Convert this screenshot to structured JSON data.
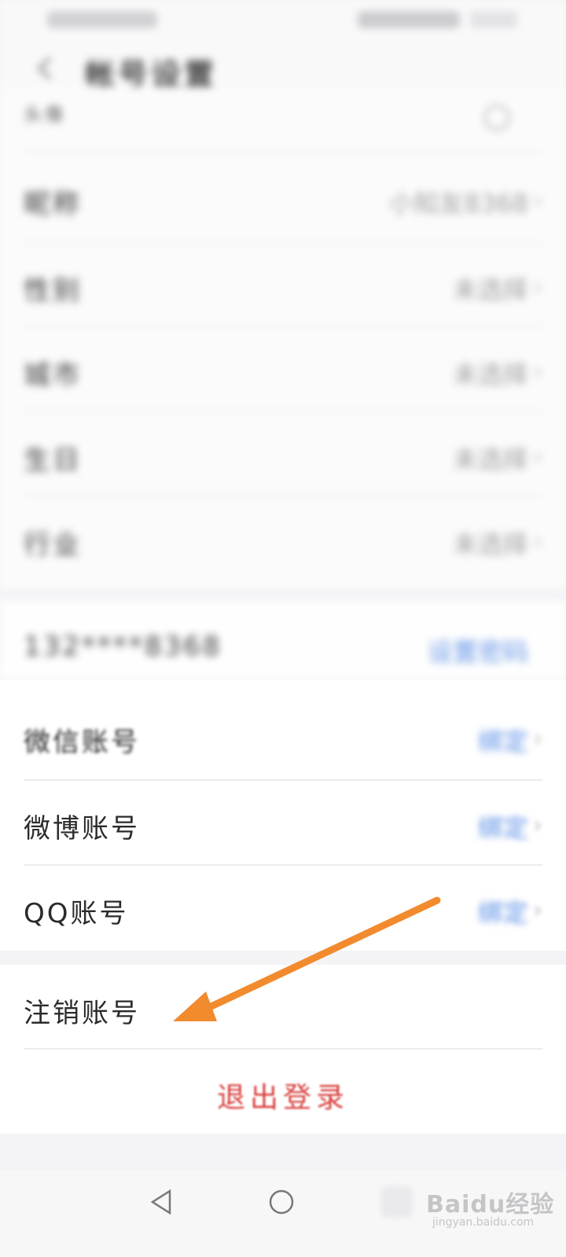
{
  "header": {
    "title": "帐号设置"
  },
  "profile_rows": [
    {
      "label": "头像",
      "value": ""
    },
    {
      "label": "昵称",
      "value": "小知友8368"
    },
    {
      "label": "性别",
      "value": "未选择"
    },
    {
      "label": "城市",
      "value": "未选择"
    },
    {
      "label": "生日",
      "value": "未选择"
    },
    {
      "label": "行业",
      "value": "未选择"
    }
  ],
  "phone_row": {
    "label": "132****8368",
    "value": "设置密码"
  },
  "account_rows": [
    {
      "label": "微信账号",
      "value": "绑定"
    },
    {
      "label": "微博账号",
      "value": "绑定"
    },
    {
      "label": "QQ账号",
      "value": "绑定"
    }
  ],
  "cancel_account": {
    "label": "注销账号"
  },
  "logout": {
    "label": "退出登录"
  },
  "watermark": {
    "main": "Baidu经验",
    "sub": "jingyan.baidu.com"
  },
  "colors": {
    "logout": "#d8403e",
    "link": "#5b8fe6",
    "arrow": "#f28a2e"
  }
}
